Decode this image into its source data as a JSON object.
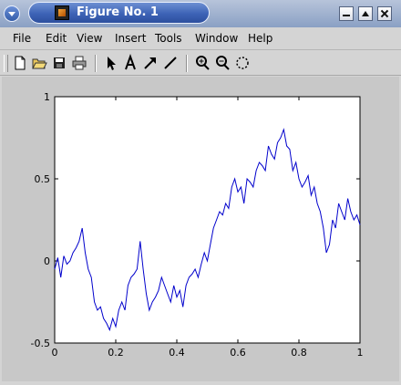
{
  "window": {
    "title": "Figure No. 1"
  },
  "menu": {
    "file": "File",
    "edit": "Edit",
    "view": "View",
    "insert": "Insert",
    "tools": "Tools",
    "window": "Window",
    "help": "Help"
  },
  "toolbar": {
    "icons": [
      "new-file-icon",
      "open-file-icon",
      "save-icon",
      "print-icon",
      "select-arrow-icon",
      "insert-text-icon",
      "insert-arrow-icon",
      "insert-line-icon",
      "zoom-in-icon",
      "zoom-out-icon",
      "rotate-icon"
    ]
  },
  "colors": {
    "line": "#0000cc",
    "figure_bg": "#c8c8c8",
    "axes_bg": "#ffffff"
  },
  "chart_data": {
    "type": "line",
    "title": "",
    "xlabel": "",
    "ylabel": "",
    "xlim": [
      0,
      1
    ],
    "ylim": [
      -0.5,
      1
    ],
    "xticks": [
      0,
      0.2,
      0.4,
      0.6,
      0.8,
      1
    ],
    "xtick_labels": [
      "0",
      "0.2",
      "0.4",
      "0.6",
      "0.8",
      "1"
    ],
    "yticks": [
      -0.5,
      0,
      0.5,
      1
    ],
    "ytick_labels": [
      "-0.5",
      "0",
      "0.5",
      "1"
    ],
    "grid": false,
    "series": [
      {
        "x": [
          0,
          0.01,
          0.02,
          0.03,
          0.04,
          0.05,
          0.06,
          0.07,
          0.08,
          0.09,
          0.1,
          0.11,
          0.12,
          0.13,
          0.14,
          0.15,
          0.16,
          0.17,
          0.18,
          0.19,
          0.2,
          0.21,
          0.22,
          0.23,
          0.24,
          0.25,
          0.26,
          0.27,
          0.28,
          0.29,
          0.3,
          0.31,
          0.32,
          0.33,
          0.34,
          0.35,
          0.36,
          0.37,
          0.38,
          0.39,
          0.4,
          0.41,
          0.42,
          0.43,
          0.44,
          0.45,
          0.46,
          0.47,
          0.48,
          0.49,
          0.5,
          0.51,
          0.52,
          0.53,
          0.54,
          0.55,
          0.56,
          0.57,
          0.58,
          0.59,
          0.6,
          0.61,
          0.62,
          0.63,
          0.64,
          0.65,
          0.66,
          0.67,
          0.68,
          0.69,
          0.7,
          0.71,
          0.72,
          0.73,
          0.74,
          0.75,
          0.76,
          0.77,
          0.78,
          0.79,
          0.8,
          0.81,
          0.82,
          0.83,
          0.84,
          0.85,
          0.86,
          0.87,
          0.88,
          0.89,
          0.9,
          0.91,
          0.92,
          0.93,
          0.94,
          0.95,
          0.96,
          0.97,
          0.98,
          0.99,
          1.0
        ],
        "y": [
          -0.05,
          0.02,
          -0.1,
          0.03,
          -0.02,
          0.0,
          0.05,
          0.08,
          0.12,
          0.2,
          0.05,
          -0.05,
          -0.1,
          -0.25,
          -0.3,
          -0.28,
          -0.35,
          -0.38,
          -0.42,
          -0.35,
          -0.4,
          -0.3,
          -0.25,
          -0.3,
          -0.15,
          -0.1,
          -0.08,
          -0.05,
          0.12,
          -0.05,
          -0.2,
          -0.3,
          -0.25,
          -0.22,
          -0.18,
          -0.1,
          -0.15,
          -0.2,
          -0.25,
          -0.15,
          -0.22,
          -0.18,
          -0.28,
          -0.15,
          -0.1,
          -0.08,
          -0.05,
          -0.1,
          -0.02,
          0.05,
          0.0,
          0.1,
          0.2,
          0.25,
          0.3,
          0.28,
          0.35,
          0.32,
          0.45,
          0.5,
          0.42,
          0.45,
          0.35,
          0.5,
          0.48,
          0.45,
          0.55,
          0.6,
          0.58,
          0.55,
          0.7,
          0.65,
          0.62,
          0.72,
          0.75,
          0.8,
          0.7,
          0.68,
          0.55,
          0.6,
          0.5,
          0.45,
          0.48,
          0.52,
          0.4,
          0.45,
          0.35,
          0.3,
          0.2,
          0.05,
          0.1,
          0.25,
          0.2,
          0.35,
          0.3,
          0.25,
          0.38,
          0.3,
          0.25,
          0.28,
          0.22
        ]
      }
    ]
  }
}
